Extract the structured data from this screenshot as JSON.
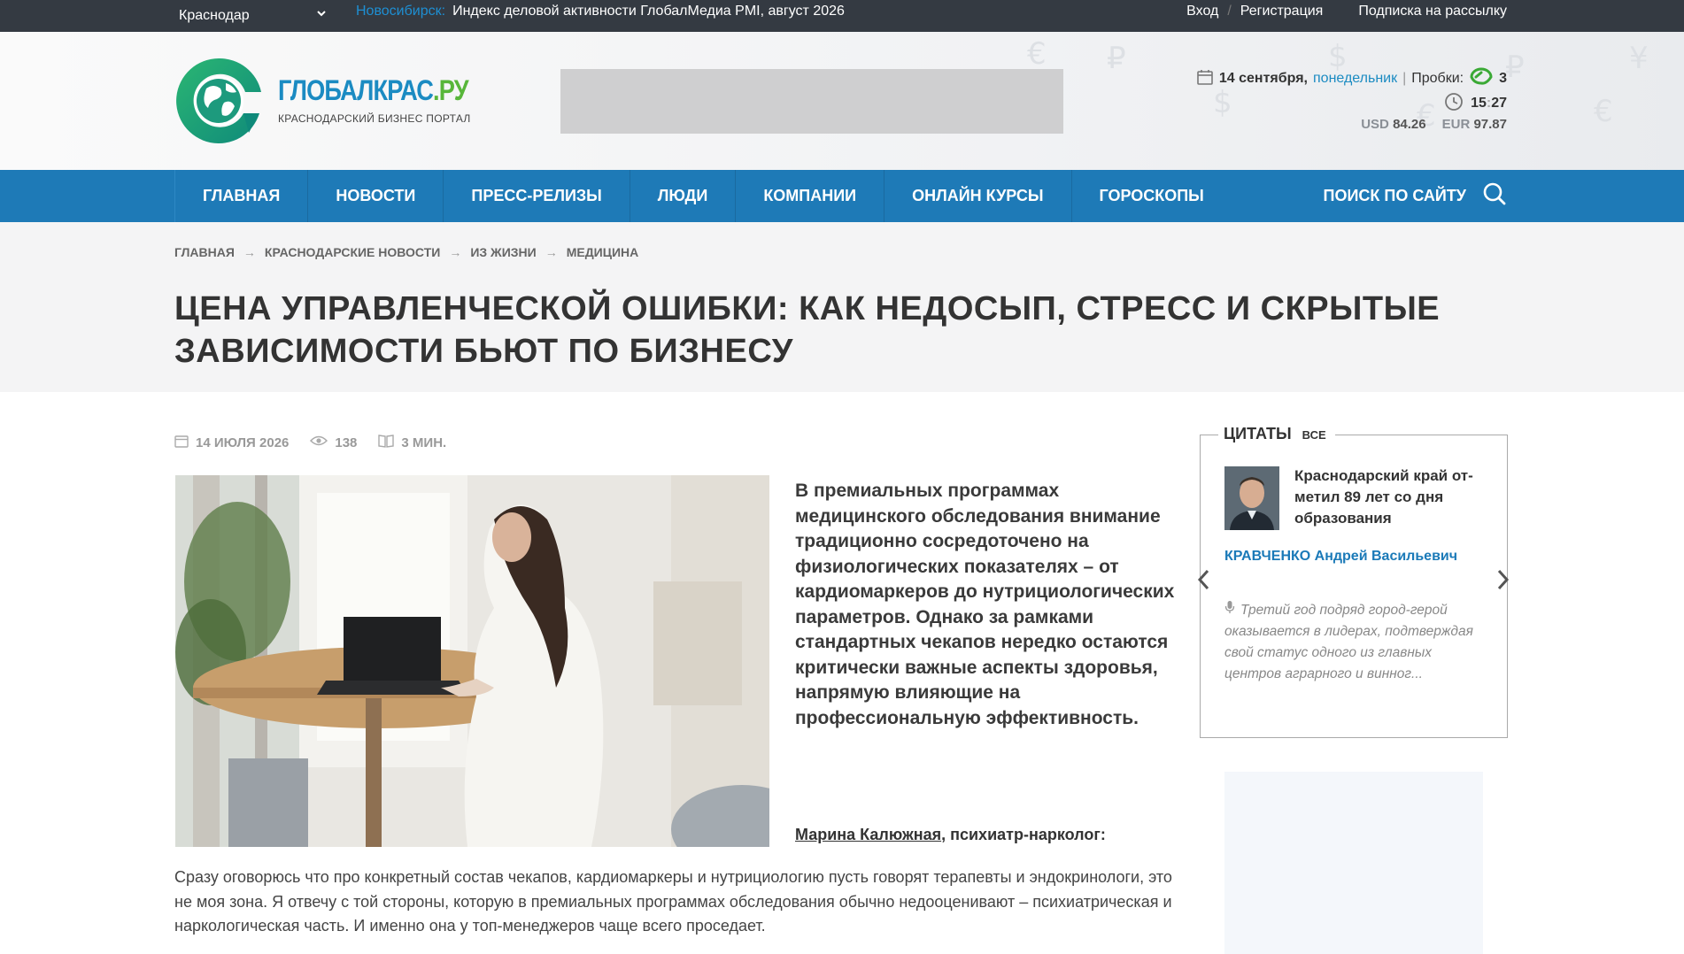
{
  "topbar": {
    "city": "Краснодар",
    "ticker_source": "Новосибирск:",
    "ticker_text": "Индекс деловой активности ГлобалМедиа PMI, август 2026",
    "login": "Вход",
    "sep": "/",
    "register": "Регистрация",
    "subscribe": "Подписка на рассылку"
  },
  "logo": {
    "brand_main": "ГЛОБАЛКРАС",
    "brand_ru": ".РУ",
    "tagline": "КРАСНОДАРСКИЙ БИЗНЕС ПОРТАЛ"
  },
  "header_info": {
    "date": "14 сентября,",
    "day_of_week": "понедельник",
    "bar": "|",
    "traffic_label": "Пробки:",
    "traffic_value": "3",
    "time_hours": "15",
    "time_minutes": "27",
    "usd_label": "USD",
    "usd_value": "84.26",
    "eur_label": "EUR",
    "eur_value": "97.87"
  },
  "nav": {
    "items": [
      "ГЛАВНАЯ",
      "НОВОСТИ",
      "ПРЕСС-РЕЛИЗЫ",
      "ЛЮДИ",
      "КОМПАНИИ",
      "ОНЛАЙН КУРСЫ",
      "ГОРОСКОПЫ"
    ],
    "search_label": "ПОИСК ПО САЙТУ"
  },
  "breadcrumbs": [
    "ГЛАВНАЯ",
    "КРАСНОДАРСКИЕ НОВОСТИ",
    "ИЗ ЖИЗНИ",
    "МЕДИЦИНА"
  ],
  "article": {
    "title": "ЦЕНА УПРАВЛЕНЧЕСКОЙ ОШИБКИ: КАК НЕДОСЫП, СТРЕСС И СКРЫТЫЕ ЗАВИСИМОСТИ БЬЮТ ПО БИЗНЕСУ",
    "date": "14 ИЮЛЯ 2026",
    "views": "138",
    "read_time": "3 МИН.",
    "lead": "В премиальных программах медицинского обследования внимание традиционно сосредоточено на физиологических показателях – от кардиомаркеров до нутрициологических параметров. Однако за рамками стандартных чекапов нередко остаются критически важные аспекты здоровья, напрямую влияющие на профессиональную эффективность.",
    "author_name": "Марина Калюжная",
    "author_role": ", психиатр-нарколог:",
    "body": "Сразу оговорюсь что про конкретный состав чекапов, кардиомаркеры и нутрициологию пусть говорят терапевты и эндокринологи, это не моя зона. Я отвечу с той стороны, которую в премиальных программах обследования обычно недооценивают – психиатрическая и наркологическая часть. И именно она у топ-менеджеров чаще всего проседает."
  },
  "quotes": {
    "title": "ЦИТАТЫ",
    "all": "ВСЕ",
    "quote": "Краснодарский край от­метил 89 лет со дня образования",
    "person": "КРАВЧЕНКО Андрей Васильевич",
    "excerpt": "Третий год подряд город-герой оказывается в лидерах, подтвер­ждая свой статус одного из глав­ных центров аграрного и винног..."
  },
  "icons": {
    "chevron": "chevron-down-icon",
    "calendar": "calendar-icon",
    "traffic": "traffic-icon",
    "clock": "clock-icon",
    "search": "search-icon",
    "eye": "eye-icon",
    "book": "book-icon",
    "mic": "microphone-icon",
    "prev": "chevron-left-icon",
    "next": "chevron-right-icon"
  },
  "colors": {
    "accent_blue": "#1e7ab7",
    "topbar": "#343a42",
    "traffic_green": "#3aa935",
    "link_blue": "#1b8bc2"
  }
}
